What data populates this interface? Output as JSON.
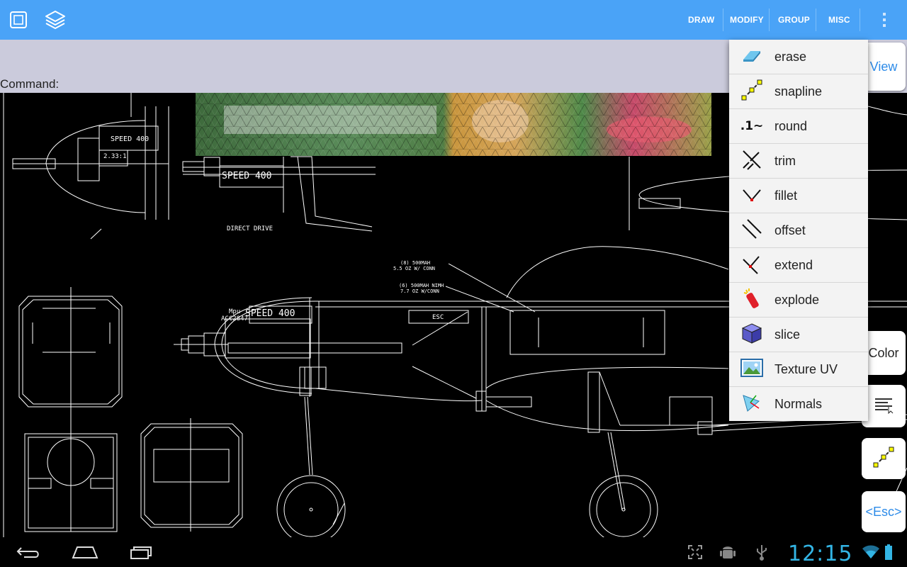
{
  "toolbar": {
    "menus": [
      "DRAW",
      "MODIFY",
      "GROUP",
      "MISC"
    ]
  },
  "command": {
    "label": "Command:",
    "value": ""
  },
  "drawing_labels": {
    "speed400_a": "SPEED 400",
    "ratio": "2.33:1",
    "speed400_b": "SPEED 400",
    "direct_drive": "DIRECT DRIVE",
    "note1a": "(8) 500MAH",
    "note1b": "5.5 OZ  W/ CONN",
    "note2a": "(6) 500MAH NIMH",
    "note2b": "7.7 OZ  W/CONN",
    "speed400_c": "SPEED 400",
    "mpu": "Mpu",
    "acc": "ACC2847",
    "esc": "ESC"
  },
  "modify_menu": {
    "items": [
      {
        "label": "erase",
        "icon": "eraser-icon"
      },
      {
        "label": "snapline",
        "icon": "snapline-icon"
      },
      {
        "label": "round",
        "icon": "round-icon"
      },
      {
        "label": "trim",
        "icon": "trim-icon"
      },
      {
        "label": "fillet",
        "icon": "fillet-icon"
      },
      {
        "label": "offset",
        "icon": "offset-icon"
      },
      {
        "label": "extend",
        "icon": "extend-icon"
      },
      {
        "label": "explode",
        "icon": "explode-icon"
      },
      {
        "label": "slice",
        "icon": "slice-cube-icon"
      },
      {
        "label": "Texture UV",
        "icon": "texture-image-icon"
      },
      {
        "label": "Normals",
        "icon": "normals-icon"
      }
    ]
  },
  "side_buttons": {
    "view": "View",
    "color": "Color",
    "esc": "<Esc>"
  },
  "status": {
    "time": "12:15"
  },
  "colors": {
    "toolbar": "#4aa3f7",
    "accent": "#2d8be8",
    "clock": "#33b5e5"
  }
}
